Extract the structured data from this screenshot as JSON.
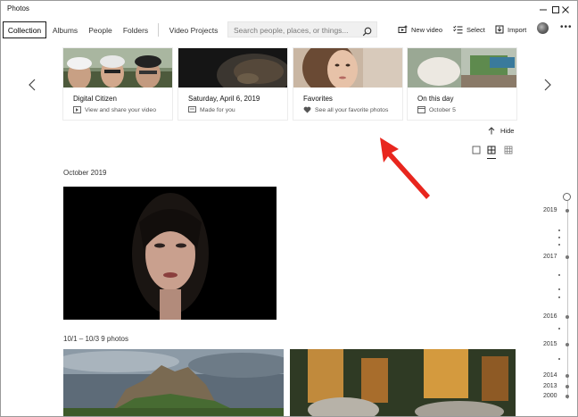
{
  "app": {
    "title": "Photos"
  },
  "tabs": [
    {
      "label": "Collection",
      "active": true
    },
    {
      "label": "Albums",
      "active": false
    },
    {
      "label": "People",
      "active": false
    },
    {
      "label": "Folders",
      "active": false
    },
    {
      "label": "Video Projects",
      "active": false
    }
  ],
  "search": {
    "placeholder": "Search people, places, or things..."
  },
  "actions": {
    "new_video": "New video",
    "select": "Select",
    "import": "Import"
  },
  "cards": [
    {
      "title": "Digital Citizen",
      "subtitle": "View and share your video",
      "icon": "video-icon"
    },
    {
      "title": "Saturday, April 6, 2019",
      "subtitle": "Made for you",
      "icon": "slideshow-icon"
    },
    {
      "title": "Favorites",
      "subtitle": "See all your favorite photos",
      "icon": "heart-icon"
    },
    {
      "title": "On this day",
      "subtitle": "October 5",
      "icon": "calendar-icon"
    }
  ],
  "hide_label": "Hide",
  "sections": [
    {
      "label": "October 2019"
    },
    {
      "label": "10/1 – 10/3   9 photos"
    }
  ],
  "timeline": {
    "years": [
      "2019",
      "2017",
      "2016",
      "2015",
      "2014",
      "2013",
      "2000"
    ]
  },
  "colors": {
    "accent_arrow": "#e8261e",
    "active_tab_border": "#1a1a1a"
  },
  "icons": [
    "minimize-icon",
    "maximize-icon",
    "close-icon",
    "search-icon",
    "new-video-icon",
    "select-icon",
    "import-icon",
    "more-icon",
    "chevron-left-icon",
    "chevron-right-icon",
    "hide-arrow-icon",
    "view-large-icon",
    "view-medium-icon",
    "view-small-icon"
  ]
}
